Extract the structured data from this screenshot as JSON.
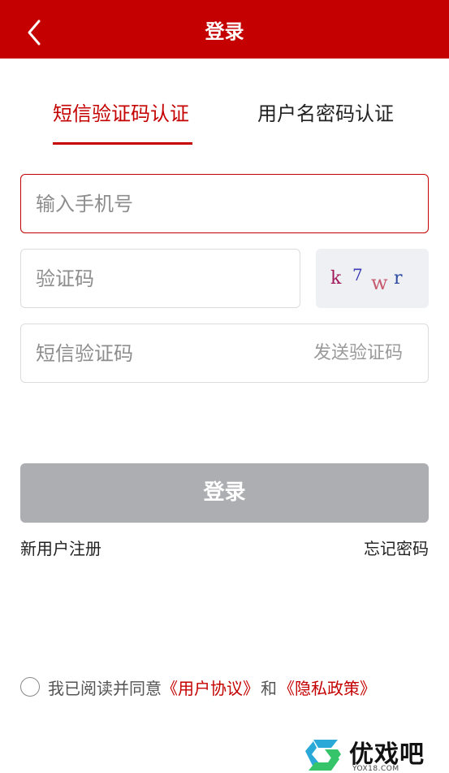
{
  "header": {
    "title": "登录",
    "back_icon": "chevron-left-icon"
  },
  "tabs": [
    {
      "label": "短信验证码认证",
      "active": true
    },
    {
      "label": "用户名密码认证",
      "active": false
    }
  ],
  "form": {
    "phone": {
      "placeholder": "输入手机号",
      "value": ""
    },
    "captcha": {
      "placeholder": "验证码",
      "value": ""
    },
    "captcha_image": {
      "chars": [
        "k",
        "7",
        "w",
        "r"
      ]
    },
    "sms_code": {
      "placeholder": "短信验证码",
      "value": ""
    },
    "send_code_label": "发送验证码"
  },
  "login_button": {
    "label": "登录"
  },
  "links": {
    "register": "新用户注册",
    "forgot": "忘记密码"
  },
  "agreement": {
    "prefix": "我已阅读并同意",
    "user_agreement": "《用户协议》",
    "and": "和",
    "privacy_policy": "《隐私政策》",
    "checked": false
  },
  "watermark": {
    "name": "优戏吧",
    "domain": "YOX18.COM"
  },
  "colors": {
    "brand": "#c40000",
    "disabled_button": "#adaeb2",
    "placeholder": "#8d8d8d"
  }
}
